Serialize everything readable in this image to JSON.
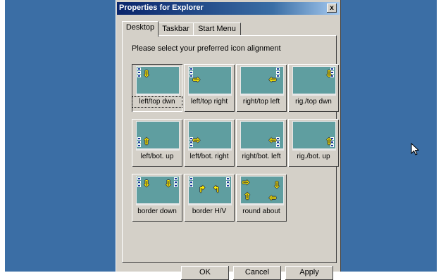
{
  "window": {
    "title": "Properties for Explorer",
    "close_glyph": "x"
  },
  "tabs": [
    {
      "label": "Desktop"
    },
    {
      "label": "Taskbar"
    },
    {
      "label": "Start Menu"
    }
  ],
  "instruction": "Please select your preferred icon alignment",
  "options": [
    {
      "label": "left/top dwn",
      "arrows": [
        "⇩"
      ],
      "selected": true
    },
    {
      "label": "left/top right",
      "arrows": [
        "⇨"
      ]
    },
    {
      "label": "right/top left",
      "arrows": [
        "⇦"
      ]
    },
    {
      "label": "rig./top dwn",
      "arrows": [
        "⇩"
      ]
    },
    {
      "label": "left/bot. up",
      "arrows": [
        "⇧"
      ]
    },
    {
      "label": "left/bot. right",
      "arrows": [
        "⇨"
      ]
    },
    {
      "label": "right/bot. left",
      "arrows": [
        "⇦"
      ]
    },
    {
      "label": "rig./bot. up",
      "arrows": [
        "⇧"
      ]
    },
    {
      "label": "border down",
      "arrows": [
        "⇩",
        "⇩"
      ]
    },
    {
      "label": "border H/V",
      "arrows": [
        "↱",
        "↰"
      ]
    },
    {
      "label": "round about",
      "arrows": [
        "⇨",
        "⇩",
        "⇧",
        "⇦"
      ]
    }
  ],
  "buttons": [
    {
      "label": "OK"
    },
    {
      "label": "Cancel"
    },
    {
      "label": "Apply"
    }
  ],
  "colors": {
    "desktop": "#3b6ea5",
    "window_face": "#d4d0c8",
    "titlebar": "#0a246a",
    "preview": "#5f9ea0",
    "arrow": "#ffee00"
  },
  "icons": {
    "cursor": "arrow-cursor-icon",
    "close": "close-icon"
  }
}
